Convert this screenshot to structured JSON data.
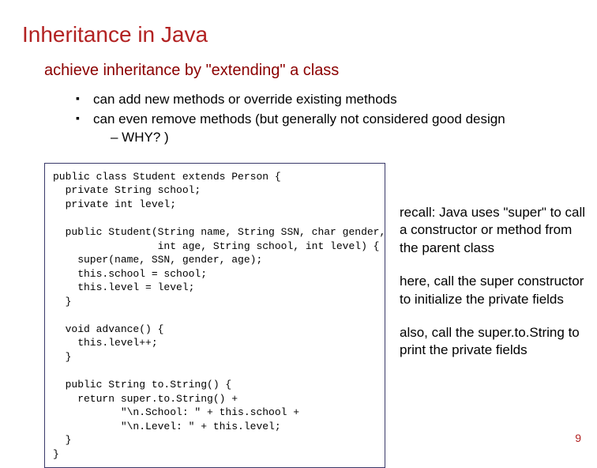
{
  "title": "Inheritance in Java",
  "subtitle": "achieve inheritance by \"extending\" a class",
  "bullets": [
    "can add new methods or override existing methods",
    "can even remove methods (but generally not considered good design",
    "– WHY? )"
  ],
  "code": "public class Student extends Person {\n  private String school;\n  private int level;\n\n  public Student(String name, String SSN, char gender,\n                 int age, String school, int level) {\n    super(name, SSN, gender, age);\n    this.school = school;\n    this.level = level;\n  }\n\n  void advance() {\n    this.level++;\n  }\n\n  public String to.String() {\n    return super.to.String() +\n           \"\\n.School: \" + this.school +\n           \"\\n.Level: \" + this.level;\n  }\n}",
  "notes": {
    "n1": "recall: Java uses \"super\" to call a constructor or method from the parent class",
    "n2": "here, call the super constructor to initialize the private fields",
    "n3": "also, call the super.to.String to print the private fields"
  },
  "page": "9"
}
